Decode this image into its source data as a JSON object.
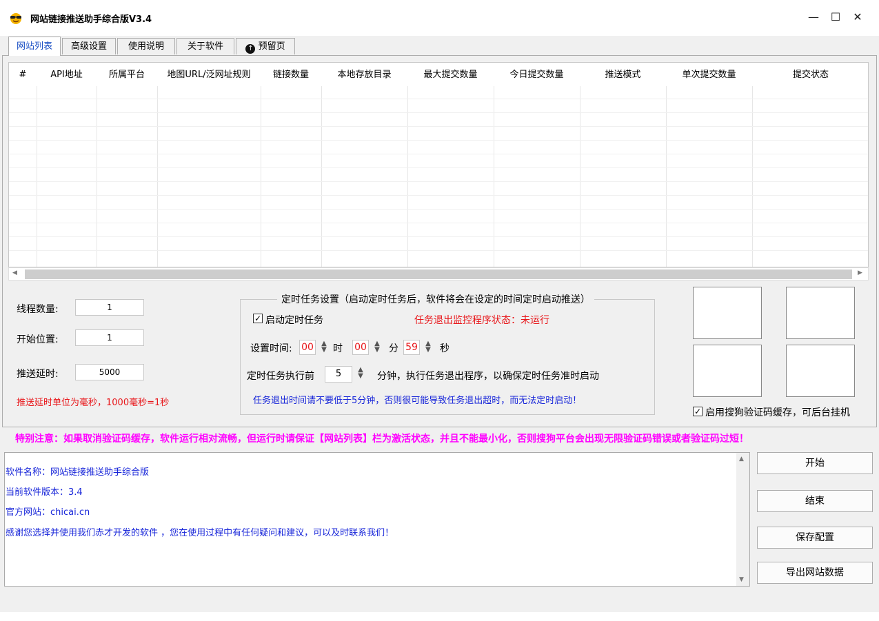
{
  "window": {
    "title": "网站链接推送助手综合版V3.4",
    "minimize": "—",
    "maximize": "☐",
    "close": "✕"
  },
  "tabs": [
    "网站列表",
    "高级设置",
    "使用说明",
    "关于软件",
    "预留页"
  ],
  "table": {
    "columns": [
      "#",
      "API地址",
      "所属平台",
      "地图URL/泛网址规则",
      "链接数量",
      "本地存放目录",
      "最大提交数量",
      "今日提交数量",
      "推送模式",
      "单次提交数量",
      "提交状态"
    ],
    "rows": []
  },
  "settings": {
    "threads_label": "线程数量:",
    "threads_value": "1",
    "start_label": "开始位置:",
    "start_value": "1",
    "delay_label": "推送延时:",
    "delay_value": "5000",
    "delay_note": "推送延时单位为毫秒，1000毫秒=1秒"
  },
  "schedule": {
    "group_title": "定时任务设置（启动定时任务后，软件将会在设定的时间定时启动推送）",
    "enable_label": "启动定时任务",
    "enable_checked": true,
    "monitor_status": "任务退出监控程序状态：未运行",
    "time_label": "设置时间:",
    "hour": "00",
    "hour_unit": "时",
    "minute": "00",
    "minute_unit": "分",
    "second": "59",
    "second_unit": "秒",
    "before_label": "定时任务执行前",
    "before_value": "5",
    "before_suffix": "分钟，执行任务退出程序，以确保定时任务准时启动",
    "warning": "任务退出时间请不要低于5分钟，否则很可能导致任务退出超时，而无法定时启动！"
  },
  "captcha": {
    "cache_label": "启用搜狗验证码缓存，可后台挂机",
    "cache_checked": true
  },
  "notice": "特别注意：如果取消验证码缓存，软件运行相对流畅，但运行时请保证【网站列表】栏为激活状态，并且不能最小化，否则搜狗平台会出现无限验证码错误或者验证码过短！",
  "log": [
    "软件名称：网站链接推送助手综合版",
    "当前软件版本：3.4",
    "官方网站：chicai.cn",
    "感谢您选择并使用我们赤才开发的软件 ，您在使用过程中有任何疑问和建议，可以及时联系我们！"
  ],
  "buttons": {
    "start": "开始",
    "stop": "结束",
    "save": "保存配置",
    "export": "导出网站数据"
  },
  "colors": {
    "accent_blue": "#1826d9",
    "alert_red": "#e8161a",
    "notice_magenta": "#ff00ff"
  }
}
